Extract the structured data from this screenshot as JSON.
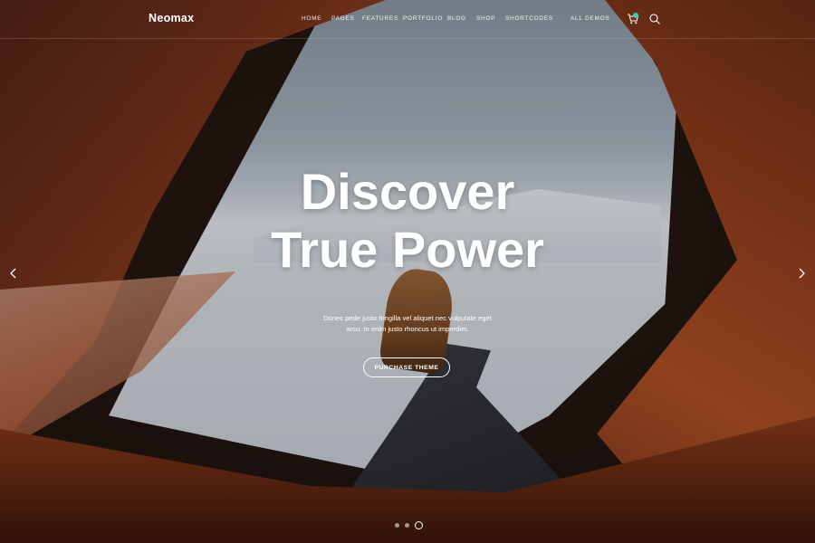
{
  "brand": {
    "name": "Neomax"
  },
  "nav": {
    "items": [
      {
        "label": "HOME"
      },
      {
        "label": "PAGES"
      },
      {
        "label": "FEATURES"
      },
      {
        "label": "PORTFOLIO"
      },
      {
        "label": "BLOG"
      },
      {
        "label": "SHOP"
      },
      {
        "label": "SHORTCODES"
      },
      {
        "label": "ALL DEMOS"
      }
    ],
    "cart_icon": "cart-icon",
    "search_icon": "search-icon"
  },
  "hero": {
    "title_line1": "Discover",
    "title_line2": "True Power",
    "subtitle_line1": "Donec pede justo fringilla vel aliquet nec vulputate eget",
    "subtitle_line2": "arcu. In enim justo rhoncus ut imperdiet.",
    "cta_label": "Purchase Theme"
  },
  "slider": {
    "prev_icon": "chevron-left-icon",
    "next_icon": "chevron-right-icon",
    "slide_count": 3,
    "active_index": 2
  },
  "colors": {
    "accent": "#3ec7c0",
    "text": "#ffffff"
  }
}
